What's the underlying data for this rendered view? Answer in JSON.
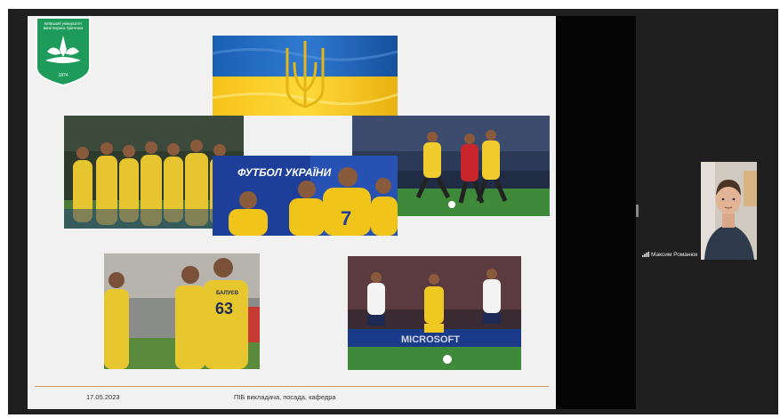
{
  "slide": {
    "logo_text": [
      "Київський університет",
      "імені Бориса Грінченка"
    ],
    "logo_year": "1874",
    "banner_title": "ФУТБОЛ УКРАЇНИ",
    "jersey_number": "7",
    "jersey_number_2": "63",
    "jersey_name": "БАЛУЄВ",
    "ad_text": "MICROSOFT",
    "footer": {
      "date": "17.05.2023",
      "author_placeholder": "ПІБ викладача, посада, кафедра"
    }
  },
  "participant": {
    "name": "Максим Романюк",
    "signal_icon": "signal-bars-icon"
  },
  "colors": {
    "app_bg": "#1f1f1f",
    "slide_bg": "#f2f1f2",
    "ukraine_blue": "#0057b7",
    "ukraine_yellow": "#ffd500",
    "logo_green": "#1e9b5a",
    "footer_line": "#d69e64"
  }
}
